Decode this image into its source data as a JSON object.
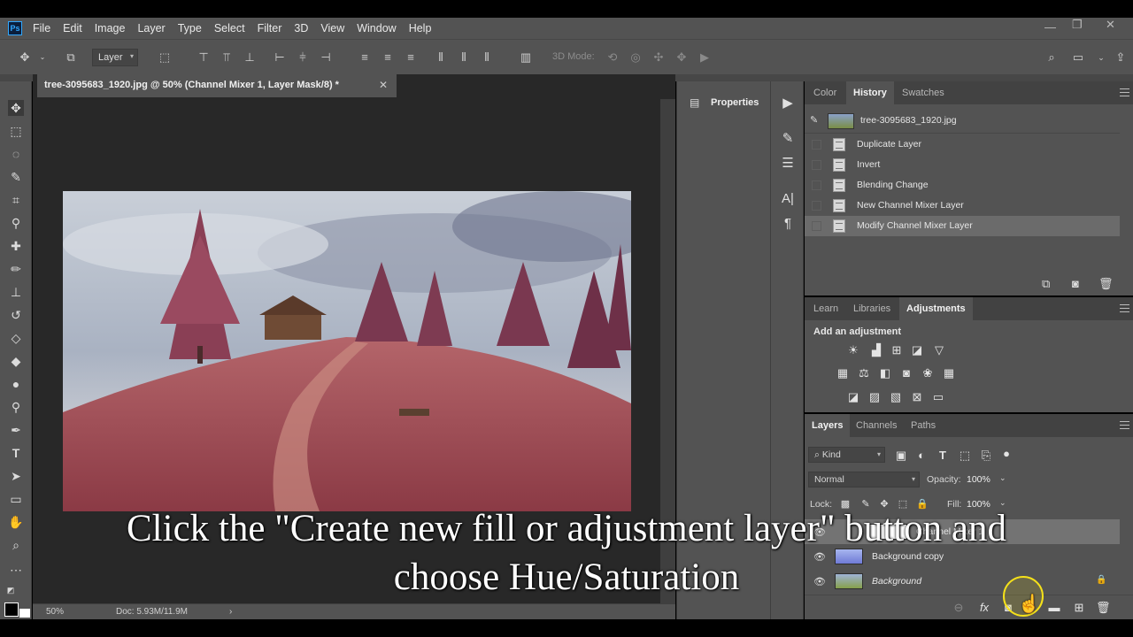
{
  "app": {
    "logo": "Ps"
  },
  "menu": [
    "File",
    "Edit",
    "Image",
    "Layer",
    "Type",
    "Select",
    "Filter",
    "3D",
    "View",
    "Window",
    "Help"
  ],
  "options": {
    "auto_select_value": "Layer",
    "mode_3d_label": "3D Mode:"
  },
  "document": {
    "tab_title": "tree-3095683_1920.jpg @ 50% (Channel Mixer 1, Layer Mask/8) *",
    "zoom": "50%",
    "doc_info": "Doc: 5.93M/11.9M"
  },
  "properties": {
    "title": "Properties"
  },
  "history_panel": {
    "tabs": [
      "Color",
      "History",
      "Swatches"
    ],
    "active_tab": "History",
    "snapshot": "tree-3095683_1920.jpg",
    "steps": [
      "Duplicate Layer",
      "Invert",
      "Blending Change",
      "New Channel Mixer Layer",
      "Modify Channel Mixer Layer"
    ],
    "selected_step": "Modify Channel Mixer Layer"
  },
  "adjustments_panel": {
    "tabs": [
      "Learn",
      "Libraries",
      "Adjustments"
    ],
    "active_tab": "Adjustments",
    "heading": "Add an adjustment"
  },
  "layers_panel": {
    "tabs": [
      "Layers",
      "Channels",
      "Paths"
    ],
    "active_tab": "Layers",
    "filter_kind": "Kind",
    "blend_mode": "Normal",
    "opacity_label": "Opacity:",
    "opacity": "100%",
    "lock_label": "Lock:",
    "fill_label": "Fill:",
    "fill": "100%",
    "layers": [
      {
        "name": "Channel Mixer 1",
        "visible": true
      },
      {
        "name": "Background copy",
        "visible": true
      },
      {
        "name": "Background",
        "visible": true,
        "locked": true
      }
    ]
  },
  "caption": {
    "line1": "Click the \"Create new fill or adjustment layer\" button and",
    "line2": "choose Hue/Saturation"
  },
  "colors": {
    "accent": "#31a8ff",
    "panel_bg": "#535353",
    "canvas_bg": "#282828",
    "cursor_highlight": "#f5e11a"
  }
}
